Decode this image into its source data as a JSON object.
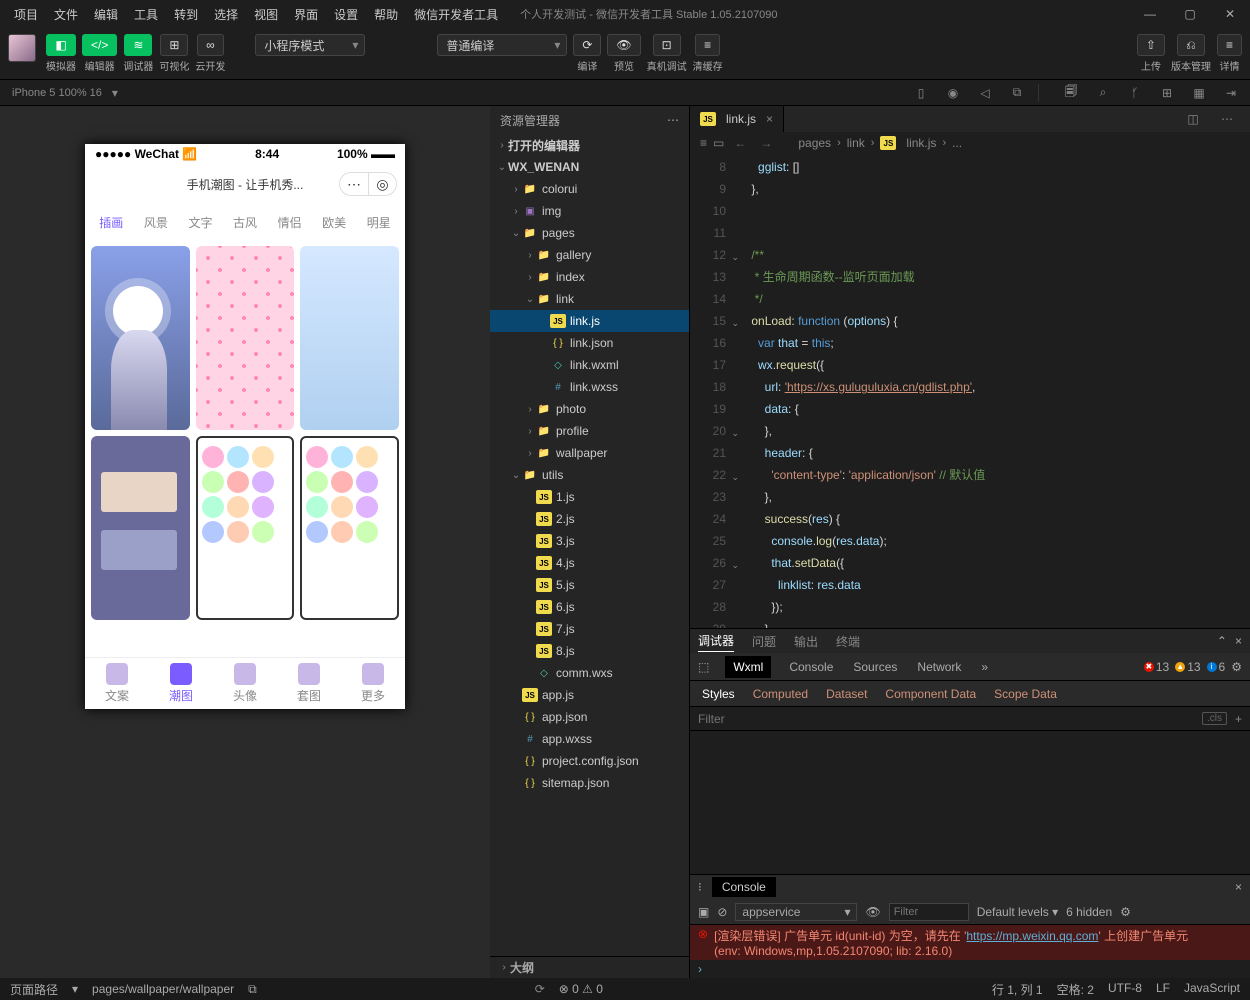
{
  "menu": [
    "项目",
    "文件",
    "编辑",
    "工具",
    "转到",
    "选择",
    "视图",
    "界面",
    "设置",
    "帮助",
    "微信开发者工具"
  ],
  "title": "个人开发测试 - 微信开发者工具 Stable 1.05.2107090",
  "toolbar": {
    "groups": [
      "模拟器",
      "编辑器",
      "调试器",
      "可视化",
      "云开发"
    ],
    "mode": "小程序模式",
    "compile": "普通编译",
    "actions": [
      "编译",
      "预览",
      "真机调试",
      "清缓存"
    ],
    "right": [
      "上传",
      "版本管理",
      "详情"
    ]
  },
  "device": "iPhone 5 100% 16",
  "phone": {
    "carrier": "●●●●● WeChat",
    "wifi": "📶",
    "time": "8:44",
    "battery": "100%",
    "title": "手机潮图 - 让手机秀...",
    "tabs": [
      "插画",
      "风景",
      "文字",
      "古风",
      "情侣",
      "欧美",
      "明星"
    ],
    "bottom": [
      "文案",
      "潮图",
      "头像",
      "套图",
      "更多"
    ]
  },
  "explorer": {
    "title": "资源管理器",
    "sections": {
      "open_editors": "打开的编辑器",
      "project": "WX_WENAN",
      "outline": "大纲"
    },
    "tree": [
      {
        "d": 1,
        "t": "folder",
        "n": "colorui"
      },
      {
        "d": 1,
        "t": "img",
        "n": "img"
      },
      {
        "d": 1,
        "t": "folder",
        "n": "pages",
        "open": true
      },
      {
        "d": 2,
        "t": "folder",
        "n": "gallery"
      },
      {
        "d": 2,
        "t": "folder",
        "n": "index"
      },
      {
        "d": 2,
        "t": "folder",
        "n": "link",
        "open": true
      },
      {
        "d": 3,
        "t": "js",
        "n": "link.js",
        "sel": true
      },
      {
        "d": 3,
        "t": "json",
        "n": "link.json"
      },
      {
        "d": 3,
        "t": "wxml",
        "n": "link.wxml"
      },
      {
        "d": 3,
        "t": "wxss",
        "n": "link.wxss"
      },
      {
        "d": 2,
        "t": "folder",
        "n": "photo"
      },
      {
        "d": 2,
        "t": "folder",
        "n": "profile"
      },
      {
        "d": 2,
        "t": "folder",
        "n": "wallpaper"
      },
      {
        "d": 1,
        "t": "folder2",
        "n": "utils",
        "open": true
      },
      {
        "d": 2,
        "t": "js",
        "n": "1.js"
      },
      {
        "d": 2,
        "t": "js",
        "n": "2.js"
      },
      {
        "d": 2,
        "t": "js",
        "n": "3.js"
      },
      {
        "d": 2,
        "t": "js",
        "n": "4.js"
      },
      {
        "d": 2,
        "t": "js",
        "n": "5.js"
      },
      {
        "d": 2,
        "t": "js",
        "n": "6.js"
      },
      {
        "d": 2,
        "t": "js",
        "n": "7.js"
      },
      {
        "d": 2,
        "t": "js",
        "n": "8.js"
      },
      {
        "d": 2,
        "t": "wxml",
        "n": "comm.wxs"
      },
      {
        "d": 1,
        "t": "js",
        "n": "app.js"
      },
      {
        "d": 1,
        "t": "json",
        "n": "app.json"
      },
      {
        "d": 1,
        "t": "wxss",
        "n": "app.wxss"
      },
      {
        "d": 1,
        "t": "json",
        "n": "project.config.json"
      },
      {
        "d": 1,
        "t": "json",
        "n": "sitemap.json"
      }
    ]
  },
  "editor": {
    "tab": "link.js",
    "breadcrumb": [
      "pages",
      "link",
      "link.js",
      "..."
    ],
    "lines_start": 8,
    "code_html": "      <span class='p'>gglist</span>: []\n    },\n\n\n    <span class='c'>/**</span>\n    <span class='c'> * 生命周期函数--监听页面加载</span>\n    <span class='c'> */</span>\n    <span class='f'>onLoad</span>: <span class='k'>function</span> (<span class='p'>options</span>) {\n      <span class='k'>var</span> <span class='p'>that</span> = <span class='k'>this</span>;\n      <span class='p'>wx</span>.<span class='f'>request</span>({\n        <span class='p'>url</span>: <span class='s url'>'https://xs.guluguluxia.cn/gdlist.php'</span>,\n        <span class='p'>data</span>: {\n        },\n        <span class='p'>header</span>: {\n          <span class='s'>'content-type'</span>: <span class='s'>'application/json'</span> <span class='c'>// 默认值</span>\n        },\n        <span class='f'>success</span>(<span class='p'>res</span>) {\n          <span class='p'>console</span>.<span class='f'>log</span>(<span class='p'>res</span>.<span class='p'>data</span>);\n          <span class='p'>that</span>.<span class='f'>setData</span>({\n            <span class='p'>linklist</span>: <span class='p'>res</span>.<span class='p'>data</span>\n          });\n        }\n      })",
    "folds": [
      5,
      8,
      13,
      15,
      19
    ]
  },
  "debugger": {
    "tabs": [
      "调试器",
      "问题",
      "输出",
      "终端"
    ],
    "devtools": [
      "Wxml",
      "Console",
      "Sources",
      "Network"
    ],
    "err_count": "13",
    "warn_count": "13",
    "info_count": "6",
    "styles": [
      "Styles",
      "Computed",
      "Dataset",
      "Component Data",
      "Scope Data"
    ],
    "filter_ph": "Filter",
    "cls": ".cls"
  },
  "console": {
    "title": "Console",
    "ctx": "appservice",
    "filter_ph": "Filter",
    "levels": "Default levels",
    "hidden": "6 hidden",
    "err1": "[渲染层错误] 广告单元 id(unit-id) 为空，请先在 '",
    "err1_link": "https://mp.weixin.qq.com",
    "err1_b": "' 上创建广告单元",
    "err2": "(env: Windows,mp,1.05.2107090; lib: 2.16.0)"
  },
  "status": {
    "left_label": "页面路径",
    "path": "pages/wallpaper/wallpaper",
    "errs": "0",
    "warns": "0",
    "right": [
      "行 1, 列 1",
      "空格: 2",
      "UTF-8",
      "LF",
      "JavaScript"
    ]
  }
}
